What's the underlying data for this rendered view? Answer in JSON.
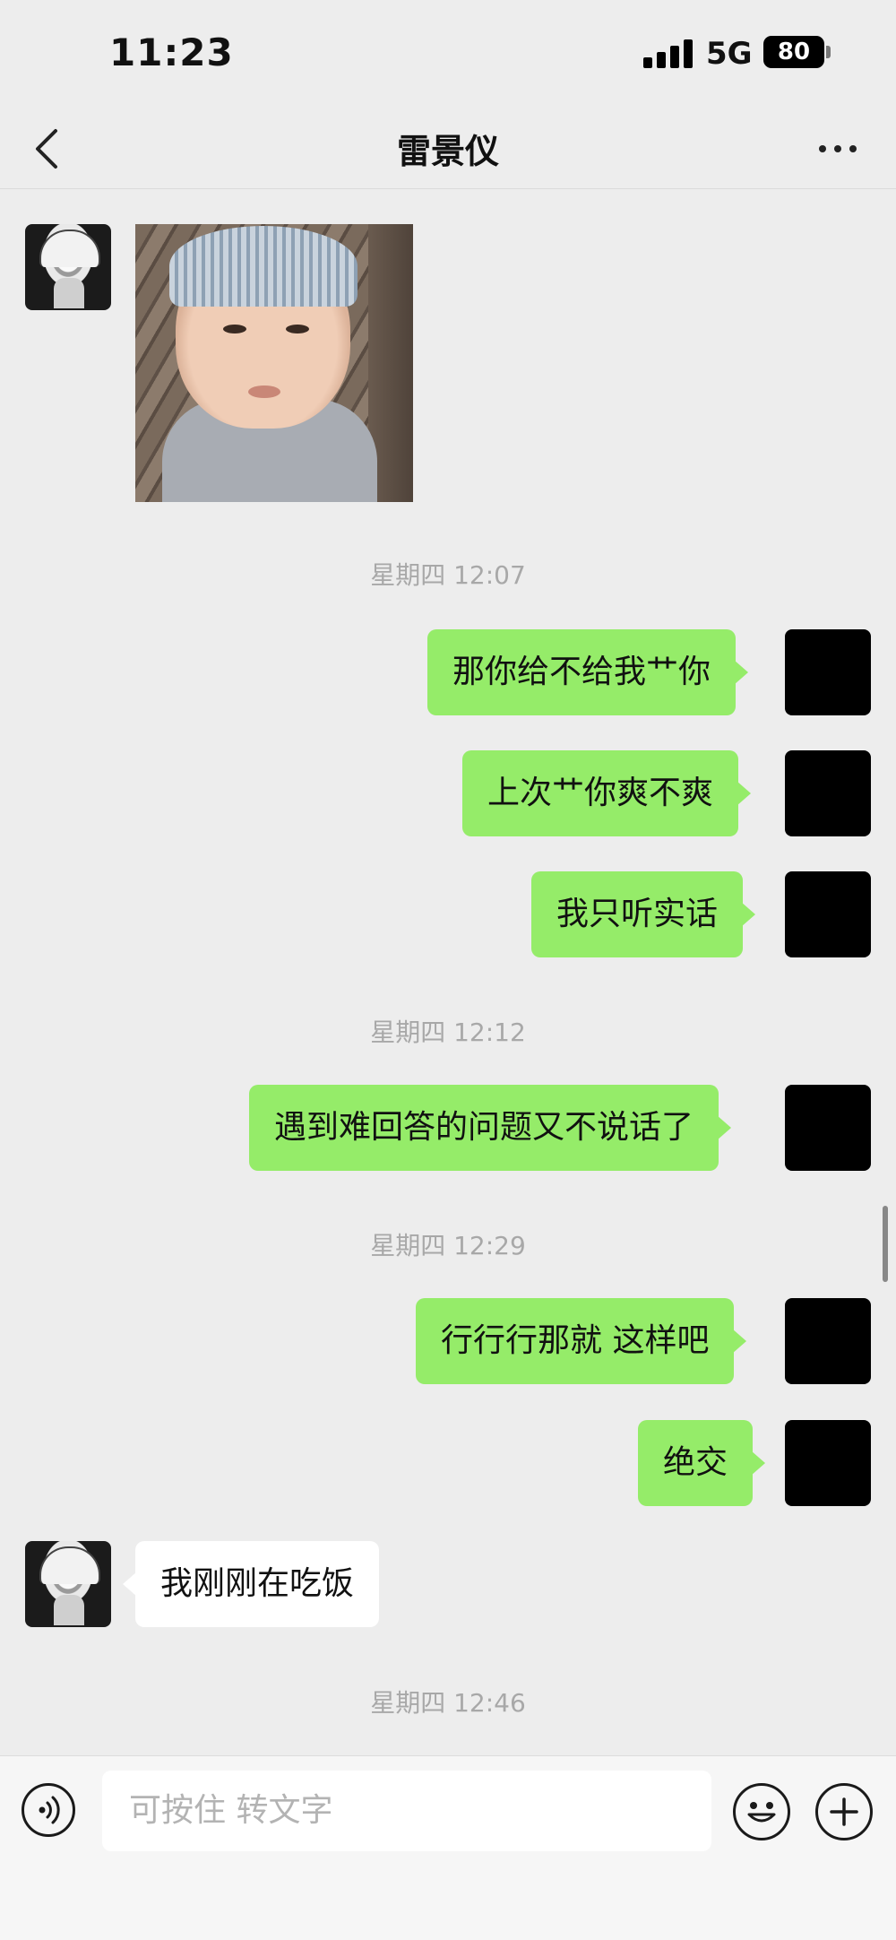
{
  "status_bar": {
    "time": "11:23",
    "network": "5G",
    "battery": "80"
  },
  "nav": {
    "title": "雷景仪",
    "back_icon": "chevron-left-icon",
    "more_icon": "more-dots-icon"
  },
  "chat": {
    "timestamps": [
      "星期四 12:07",
      "星期四 12:12",
      "星期四 12:29",
      "星期四 12:46"
    ],
    "messages_group1": [
      "那你给不给我艹你",
      "上次艹你爽不爽",
      "我只听实话"
    ],
    "messages_group2": [
      "遇到难回答的问题又不说话了"
    ],
    "messages_group3": [
      "行行行那就 这样吧",
      "绝交"
    ],
    "reply": "我刚刚在吃饭"
  },
  "input_bar": {
    "placeholder": "可按住 转文字",
    "voice_icon": "voice-icon",
    "emoji_icon": "emoji-icon",
    "plus_icon": "plus-icon"
  },
  "colors": {
    "my_bubble": "#95ec69",
    "their_bubble": "#ffffff",
    "background": "#ededed",
    "timestamp_text": "#a8a8a8"
  }
}
